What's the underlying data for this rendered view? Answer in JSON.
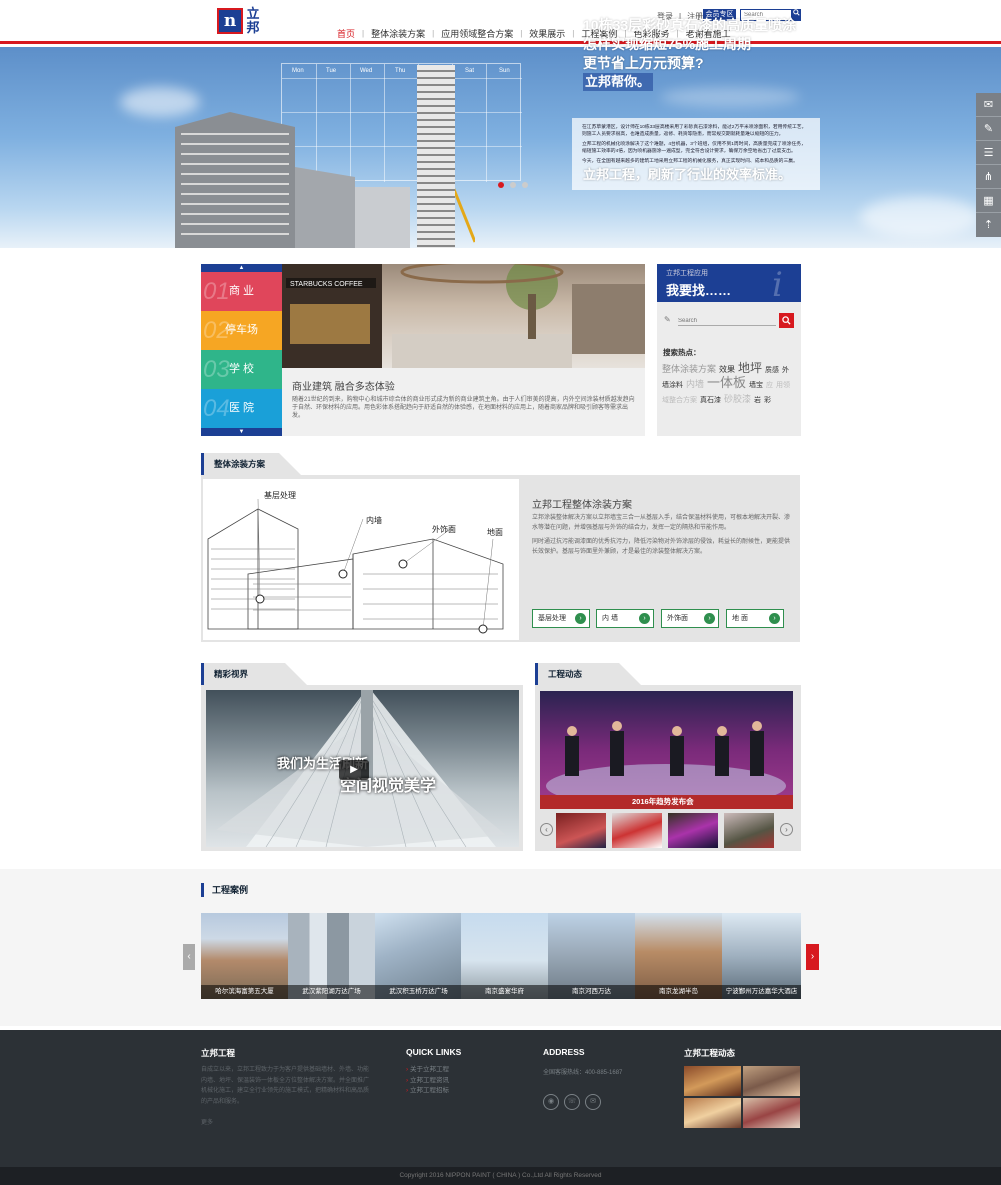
{
  "header": {
    "logo_mark": "n",
    "logo_text": "立邦",
    "top_links": {
      "login": "登录",
      "separator": "|",
      "register": "注册"
    },
    "member_button": "会员专区",
    "search_placeholder": "Search",
    "nav": [
      "首页",
      "整体涂装方案",
      "应用领域整合方案",
      "效果展示",
      "工程案例",
      "色彩服务",
      "老谢看施工"
    ],
    "active_nav": "首页",
    "accent_color": "#d7191f",
    "brand_color": "#1c3f94"
  },
  "banner": {
    "calendar_days": [
      "Mon",
      "Tue",
      "Wed",
      "Thu",
      "Sat",
      "Sun"
    ],
    "headline_lines": [
      "10栋33层彩砂真石漆的高质量喷涂",
      "怎样实现缩短75%施工周期",
      "更节省上万元预算?"
    ],
    "subheadline": "立邦帮你。",
    "paragraphs": [
      "在江苏草蒙港区，设计师在10栋33层高楼采用了彩砂真石漆涂料，能过2万平米喷涂面积，若用传统工艺，则施工人员要求很高，也难造成质量，返修、耗资等隐患，而常规交期就耗量难以缩短的压力。",
      "立邦工程的机械化喷涂解决了这个难题，4台机器，3个班组，仅用不到1周时间，高质量完成了喷涂任务，缩短施工效率的4倍，因为喷机器施涂一遍成型，完全符合设计要求，确保万余空地省出了过度支出。",
      "今天，在全国有越来越多的建筑工地采用立邦工程的机械化服务，真正实现时间、成本和品质的三赢。"
    ],
    "slogan": "立邦工程，刷新了行业的效率标准。",
    "dot_count": 3,
    "active_dot": 0
  },
  "sidebar_tools": [
    "chat-icon",
    "mail-icon",
    "list-icon",
    "share-icon",
    "qrcode-icon",
    "top-icon"
  ],
  "categories": {
    "items": [
      {
        "num": "01",
        "label": "商 业",
        "color": "#e0465b"
      },
      {
        "num": "02",
        "label": "停车场",
        "color": "#f6a623"
      },
      {
        "num": "03",
        "label": "学 校",
        "color": "#2fb58a"
      },
      {
        "num": "04",
        "label": "医 院",
        "color": "#1aa0d8"
      }
    ],
    "up_arrow": "▲",
    "down_arrow": "▼"
  },
  "feature": {
    "sign_text": "STARBUCKS COFFEE",
    "title": "商业建筑 融合多态体验",
    "body": "随着21世纪的到来，购物中心和城市综合体的商业形式成为新的商业建筑主角。由于人们审美的提高，内外空间涂装材质越发趋向于自然、环保材料的应用。用色彩体系搭配趋向于舒适自然的体验感，在地面材料的应用上，随着商家品牌和吸引顾客等需求出发。"
  },
  "finder": {
    "subtitle": "立邦工程应用",
    "title": "我要找……",
    "icon_letter": "i",
    "search_placeholder": "Search",
    "hot_label": "搜索热点：",
    "hot_tags": [
      {
        "text": "整体涂装方案",
        "size": 9,
        "color": "#999"
      },
      {
        "text": "效果",
        "size": 8,
        "color": "#333"
      },
      {
        "text": "地坪",
        "size": 12,
        "color": "#555"
      },
      {
        "text": "质感",
        "size": 7,
        "color": "#333"
      },
      {
        "text": "外墙涂料",
        "size": 7,
        "color": "#333"
      },
      {
        "text": "内墙",
        "size": 9,
        "color": "#bbb"
      },
      {
        "text": "一体板",
        "size": 13,
        "color": "#888"
      },
      {
        "text": "墙宝",
        "size": 7,
        "color": "#333"
      },
      {
        "text": "应",
        "size": 7,
        "color": "#bbb"
      },
      {
        "text": "用领域整合方案",
        "size": 7,
        "color": "#bbb"
      },
      {
        "text": "真石漆",
        "size": 7,
        "color": "#333"
      },
      {
        "text": "砂胶漆",
        "size": 9,
        "color": "#bbb"
      },
      {
        "text": "岩",
        "size": 7,
        "color": "#333"
      },
      {
        "text": "彩",
        "size": 7,
        "color": "#333"
      }
    ]
  },
  "coating": {
    "tab": "整体涂装方案",
    "labels": [
      "基层处理",
      "内墙",
      "外饰面",
      "地面"
    ],
    "title": "立邦工程整体涂装方案",
    "body1": "立邦涂装整体解决方案以立邦墙宝三合一从基层入手，结合保温材料使用，可根本地解决开裂、渗水等潜在问题，并增强基层与外饰的结合力，发挥一定的隔热和节能作用。",
    "body2": "同时通过抗污能调漆面的优秀抗污力，降低污染物对外饰涂层的侵蚀，耗益长的耐候性，更能提供长效保护。基层与饰面里外兼顾，才是最佳的涂装整体解决方案。",
    "buttons": [
      "基层处理",
      "内 墙",
      "外饰面",
      "地 面"
    ],
    "button_arrow": "›"
  },
  "vision": {
    "tab": "精彩视界",
    "text1": "我们为生活刷新",
    "text2": "空间视觉美学",
    "play": "▶"
  },
  "news": {
    "tab": "工程动态",
    "caption": "2016年趋势发布会",
    "prev": "‹",
    "next": "›"
  },
  "cases": {
    "title": "工程案例",
    "items": [
      "哈尔滨海富第五大厦",
      "武汉紫阳湖万达广场",
      "武汉积玉桥万达广场",
      "南京盛宴华府",
      "南京河西万达",
      "南京龙湖半岛",
      "宁波鄞州万达嘉华大酒店"
    ],
    "prev": "‹",
    "next": "›"
  },
  "footer": {
    "col1_title": "立邦工程",
    "col1_body": "自成立以来，立邦工程致力于为客户提供基础墙材、外墙、功能内墙、地坪、保温装饰一体板全方位整体解决方案。并全面推广机械化施工，建立全行业领先的施工模式，把精确材料和高品质的产品和服务。",
    "more": "更多",
    "col2_title": "QUICK LINKS",
    "links": [
      "关于立邦工程",
      "立邦工程资讯",
      "立邦工程招标"
    ],
    "col3_title": "ADDRESS",
    "phone": "全国客服热线：400-885-1687",
    "icons": [
      "weibo-icon",
      "wechat-icon",
      "email-icon"
    ],
    "col4_title": "立邦工程动态",
    "copyright": "Copyright 2016 NIPPON PAINT ( CHINA ) Co.,Ltd All Rights Reserved"
  }
}
